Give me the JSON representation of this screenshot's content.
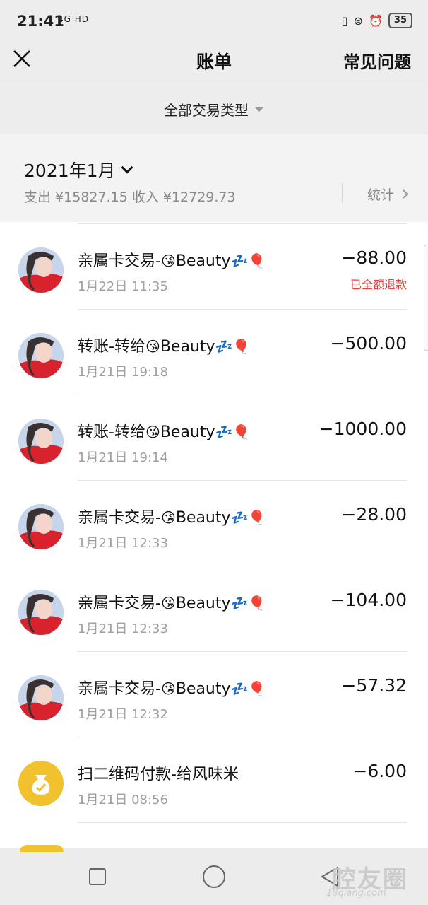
{
  "status_bar": {
    "time": "21:41",
    "network": "4G HD",
    "battery": "35"
  },
  "header": {
    "title": "账单",
    "right_action": "常见问题"
  },
  "filter": {
    "label": "全部交易类型"
  },
  "summary": {
    "month": "2021年1月",
    "totals": "支出 ¥15827.15 收入 ¥12729.73",
    "stats_label": "统计"
  },
  "transactions": [
    {
      "title": "亲属卡交易-",
      "name_suffix": "Beauty",
      "time": "1月22日 11:35",
      "amount": "−88.00",
      "note": "已全额退款"
    },
    {
      "title": "转账-转给",
      "name_suffix": "Beauty",
      "time": "1月21日 19:18",
      "amount": "−500.00",
      "note": ""
    },
    {
      "title": "转账-转给",
      "name_suffix": "Beauty",
      "time": "1月21日 19:14",
      "amount": "−1000.00",
      "note": ""
    },
    {
      "title": "亲属卡交易-",
      "name_suffix": "Beauty",
      "time": "1月21日 12:33",
      "amount": "−28.00",
      "note": ""
    },
    {
      "title": "亲属卡交易-",
      "name_suffix": "Beauty",
      "time": "1月21日 12:33",
      "amount": "−104.00",
      "note": ""
    },
    {
      "title": "亲属卡交易-",
      "name_suffix": "Beauty",
      "time": "1月21日 12:32",
      "amount": "−57.32",
      "note": ""
    },
    {
      "title": "扫二维码付款-给风味米",
      "name_suffix": "",
      "time": "1月21日 08:56",
      "amount": "−6.00",
      "note": ""
    }
  ],
  "watermark": {
    "main": "腔友圈",
    "url": "18qiang.com"
  },
  "colors": {
    "refund_note": "#e64340",
    "merchant_icon": "#f2c12e"
  }
}
